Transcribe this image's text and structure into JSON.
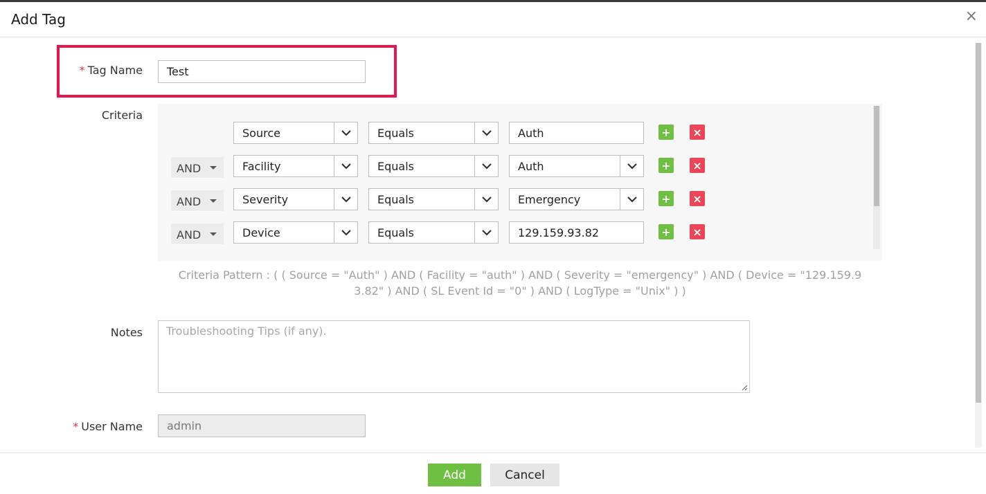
{
  "dialog": {
    "title": "Add Tag",
    "close_label": "×"
  },
  "form": {
    "tag_name_label": "Tag Name",
    "tag_name_value": "Test",
    "criteria_label": "Criteria",
    "notes_label": "Notes",
    "notes_placeholder": "Troubleshooting Tips (if any).",
    "user_name_label": "User Name",
    "user_name_value": "admin",
    "required_mark": "*"
  },
  "criteria": {
    "rows": [
      {
        "conjunction": "",
        "field": "Source",
        "operator": "Equals",
        "value": "Auth"
      },
      {
        "conjunction": "AND",
        "field": "Facility",
        "operator": "Equals",
        "value": "Auth"
      },
      {
        "conjunction": "AND",
        "field": "Severity",
        "operator": "Equals",
        "value": "Emergency"
      },
      {
        "conjunction": "AND",
        "field": "Device",
        "operator": "Equals",
        "value": "129.159.93.82"
      }
    ],
    "add_symbol": "+",
    "remove_symbol": "×",
    "pattern_line1": "Criteria Pattern : ( ( Source = \"Auth\" ) AND ( Facility = \"auth\" ) AND ( Severity = \"emergency\" ) AND ( Device = \"129.159.9",
    "pattern_line2": "3.82\" ) AND ( SL Event Id = \"0\" ) AND ( LogType = \"Unix\" ) )"
  },
  "footer": {
    "add_label": "Add",
    "cancel_label": "Cancel"
  },
  "colors": {
    "add_green": "#6fbf43",
    "remove_red": "#ea4658",
    "highlight": "#e8154d",
    "required": "#e0324c"
  }
}
